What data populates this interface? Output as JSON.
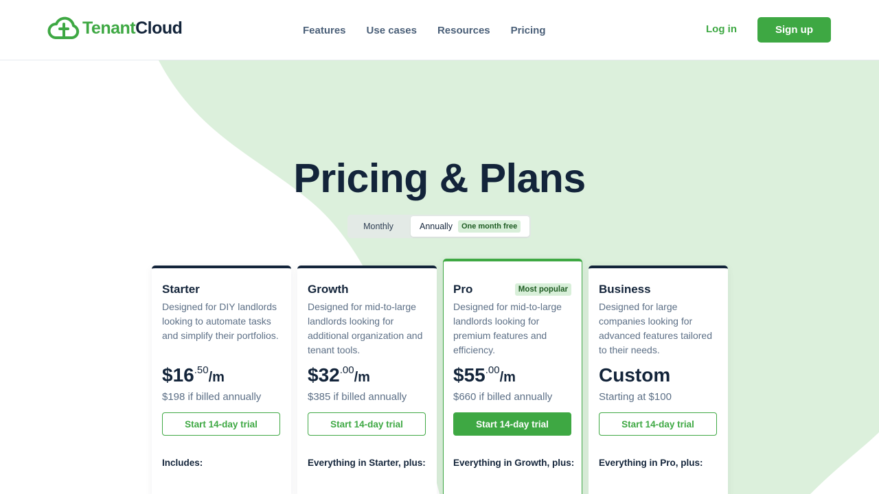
{
  "header": {
    "logo": {
      "part1": "Tenant",
      "part2": "Cloud",
      "icon": "cloud-logo-icon"
    },
    "nav": [
      "Features",
      "Use cases",
      "Resources",
      "Pricing"
    ],
    "login_label": "Log in",
    "signup_label": "Sign up"
  },
  "main": {
    "title": "Pricing & Plans",
    "billing_toggle": {
      "monthly_label": "Monthly",
      "annually_label": "Annually",
      "annually_badge": "One month free",
      "selected": "Annually"
    },
    "plans": [
      {
        "name": "Starter",
        "description": "Designed for DIY landlords looking to automate tasks and simplify their portfolios.",
        "price_main": "$16",
        "price_cents": ".50",
        "price_period": "/m",
        "billed_note": "$198 if billed annually",
        "cta_label": "Start 14-day trial",
        "includes_heading": "Includes:"
      },
      {
        "name": "Growth",
        "description": "Designed for mid-to-large landlords looking for additional organization and tenant tools.",
        "price_main": "$32",
        "price_cents": ".00",
        "price_period": "/m",
        "billed_note": "$385 if billed annually",
        "cta_label": "Start 14-day trial",
        "includes_heading": "Everything in Starter, plus:"
      },
      {
        "name": "Pro",
        "badge": "Most popular",
        "description": "Designed for mid-to-large landlords looking for premium features and efficiency.",
        "price_main": "$55",
        "price_cents": ".00",
        "price_period": "/m",
        "billed_note": "$660 if billed annually",
        "cta_label": "Start 14-day trial",
        "includes_heading": "Everything in Growth, plus:"
      },
      {
        "name": "Business",
        "description": "Designed for large companies looking for advanced features tailored to their needs.",
        "price_main": "Custom",
        "billed_note": "Starting at $100",
        "cta_label": "Start 14-day trial",
        "includes_heading": "Everything in Pro, plus:"
      }
    ]
  },
  "colors": {
    "brand_green": "#3ea843",
    "navy": "#13243a",
    "background_shape": "#dcf0dc",
    "badge_bg": "#d8efd9"
  }
}
